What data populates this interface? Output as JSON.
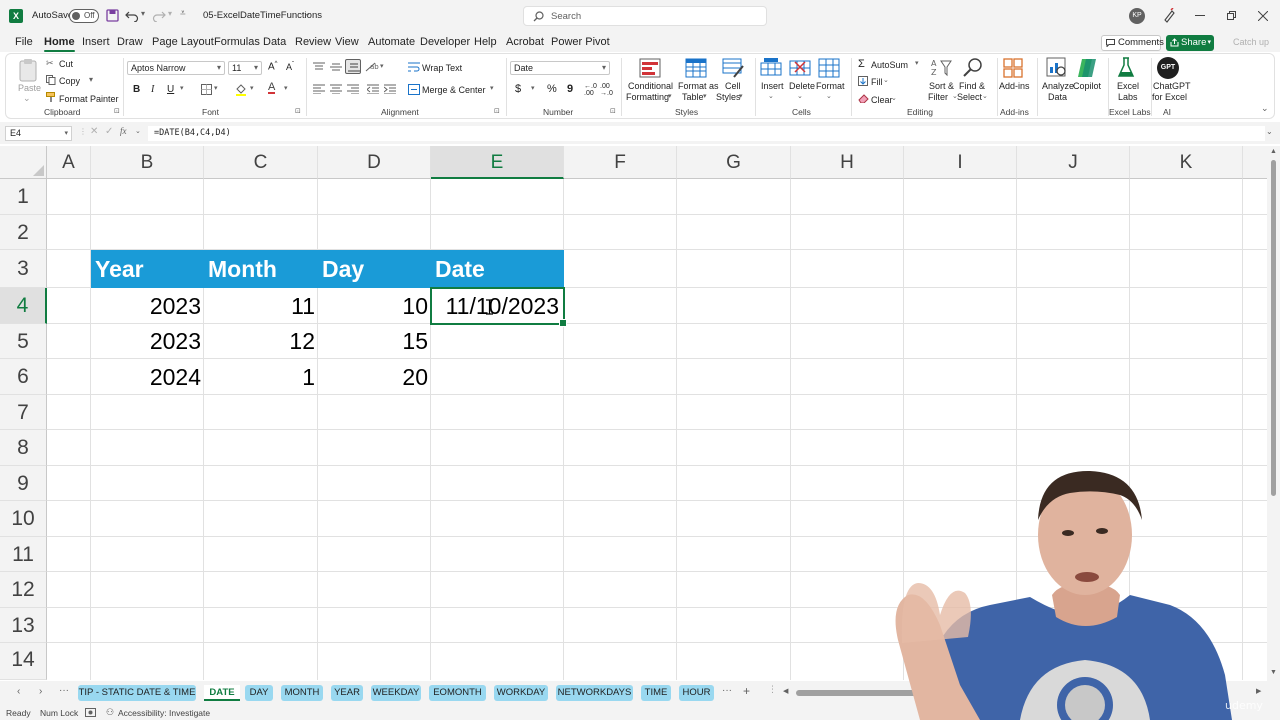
{
  "titlebar": {
    "autosave_label": "AutoSave",
    "autosave_state": "Off",
    "filename": "05-ExcelDateTimeFunctions",
    "search_placeholder": "Search",
    "user_initials": "KP"
  },
  "ribbon_tabs": [
    "File",
    "Home",
    "Insert",
    "Draw",
    "Page Layout",
    "Formulas",
    "Data",
    "Review",
    "View",
    "Automate",
    "Developer",
    "Help",
    "Acrobat",
    "Power Pivot"
  ],
  "active_tab": "Home",
  "header_actions": {
    "comments": "Comments",
    "share": "Share",
    "catch_up": "Catch up"
  },
  "ribbon": {
    "clipboard": {
      "paste": "Paste",
      "cut": "Cut",
      "copy": "Copy",
      "format_painter": "Format Painter",
      "label": "Clipboard"
    },
    "font": {
      "name": "Aptos Narrow",
      "size": "11",
      "bold": "B",
      "italic": "I",
      "underline": "U",
      "label": "Font"
    },
    "alignment": {
      "wrap": "Wrap Text",
      "merge": "Merge & Center",
      "label": "Alignment"
    },
    "number": {
      "format": "Date",
      "currency": "$",
      "percent": "%",
      "comma": "9",
      "label": "Number"
    },
    "styles": {
      "conditional_1": "Conditional",
      "conditional_2": "Formatting",
      "table_1": "Format as",
      "table_2": "Table",
      "cell_1": "Cell",
      "cell_2": "Styles",
      "label": "Styles"
    },
    "cells": {
      "insert": "Insert",
      "delete": "Delete",
      "format": "Format",
      "label": "Cells"
    },
    "editing": {
      "autosum": "AutoSum",
      "fill": "Fill",
      "clear": "Clear",
      "sort_1": "Sort &",
      "sort_2": "Filter",
      "find_1": "Find &",
      "find_2": "Select",
      "label": "Editing"
    },
    "addins": {
      "addins": "Add-ins",
      "label": "Add-ins"
    },
    "analyze": {
      "analyze_1": "Analyze",
      "analyze_2": "Data",
      "copilot": "Copilot"
    },
    "excel_labs": {
      "name_1": "Excel",
      "name_2": "Labs",
      "label": "Excel Labs"
    },
    "ai": {
      "icon_text": "GPT",
      "name_1": "ChatGPT",
      "name_2": "for Excel",
      "label": "AI"
    }
  },
  "formula_bar": {
    "name_box": "E4",
    "formula": "=DATE(B4,C4,D4)",
    "fx": "fx"
  },
  "columns": [
    "A",
    "B",
    "C",
    "D",
    "E",
    "F",
    "G",
    "H",
    "I",
    "J",
    "K"
  ],
  "rows": [
    "1",
    "2",
    "3",
    "4",
    "5",
    "6",
    "7",
    "8",
    "9",
    "10",
    "11",
    "12",
    "13",
    "14"
  ],
  "table": {
    "headers": [
      "Year",
      "Month",
      "Day",
      "Date"
    ],
    "rows": [
      [
        "2023",
        "11",
        "10",
        "11/10/2023"
      ],
      [
        "2023",
        "12",
        "15",
        ""
      ],
      [
        "2024",
        "1",
        "20",
        ""
      ]
    ]
  },
  "sheet_tabs": [
    "TIP - STATIC DATE & TIME",
    "DATE",
    "DAY",
    "MONTH",
    "YEAR",
    "WEEKDAY",
    "EOMONTH",
    "WORKDAY",
    "NETWORKDAYS",
    "TIME",
    "HOUR"
  ],
  "active_sheet": "DATE",
  "status_bar": {
    "mode": "Ready",
    "num_lock": "Num Lock",
    "accessibility": "Accessibility: Investigate"
  },
  "watermark": "udemy",
  "colors": {
    "accent": "#107c41",
    "table_header": "#1a9bd7",
    "sheet_tab": "#99d8f0"
  }
}
